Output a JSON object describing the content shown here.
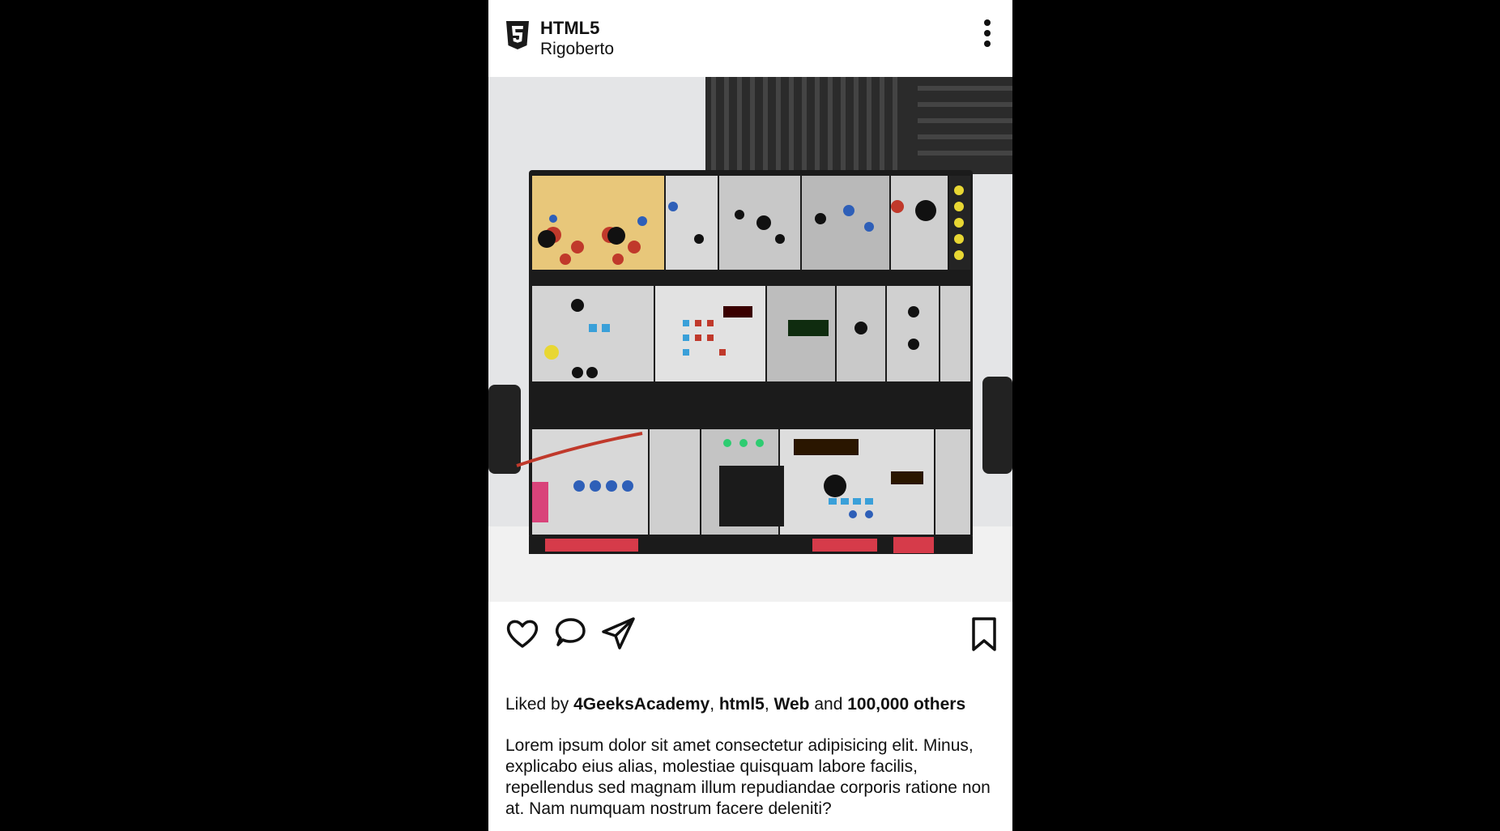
{
  "post": {
    "account_name": "HTML5",
    "location": "Rigoberto",
    "logo_icon": "html5-icon",
    "menu_icon": "more-vertical-icon",
    "image_alt": "Eurorack modular synthesizer case with three rows of modules"
  },
  "actions": {
    "like_icon": "heart-icon",
    "comment_icon": "comment-icon",
    "share_icon": "send-icon",
    "save_icon": "bookmark-icon"
  },
  "likes": {
    "prefix": "Liked by",
    "user1": "4GeeksAcademy",
    "sep1": ", ",
    "user2": "html5",
    "sep2": ", ",
    "user3": "Web",
    "and": " and ",
    "others": "100,000 others"
  },
  "caption": "Lorem ipsum dolor sit amet consectetur adipisicing elit. Minus, explicabo eius alias, molestiae quisquam labore facilis, repellendus sed magnam illum repudiandae corporis ratione non at. Nam numquam nostrum facere deleniti?",
  "colors": {
    "background": "#000000",
    "card": "#ffffff",
    "text": "#111111"
  }
}
